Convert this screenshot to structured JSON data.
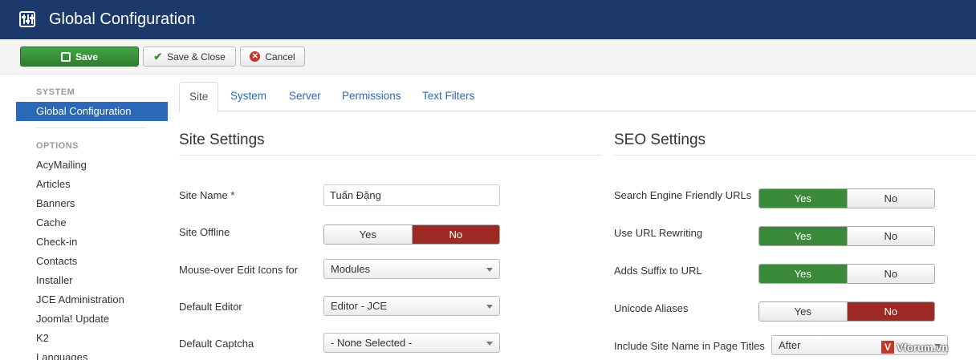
{
  "header": {
    "title": "Global Configuration",
    "logo_icon": "sliders-icon"
  },
  "toolbar": {
    "save_label": "Save",
    "save_close_label": "Save & Close",
    "cancel_label": "Cancel"
  },
  "sidebar": {
    "system_heading": "SYSTEM",
    "active_item": "Global Configuration",
    "options_heading": "OPTIONS",
    "items": [
      "AcyMailing",
      "Articles",
      "Banners",
      "Cache",
      "Check-in",
      "Contacts",
      "Installer",
      "JCE Administration",
      "Joomla! Update",
      "K2",
      "Languages"
    ]
  },
  "tabs": [
    "Site",
    "System",
    "Server",
    "Permissions",
    "Text Filters"
  ],
  "site_settings": {
    "title": "Site Settings",
    "site_name_label": "Site Name *",
    "site_name_value": "Tuấn Đặng",
    "site_offline_label": "Site Offline",
    "site_offline": {
      "yes": "Yes",
      "no": "No",
      "selected": "No"
    },
    "mouseover_label": "Mouse-over Edit Icons for",
    "mouseover_value": "Modules",
    "default_editor_label": "Default Editor",
    "default_editor_value": "Editor - JCE",
    "default_captcha_label": "Default Captcha",
    "default_captcha_value": "- None Selected -"
  },
  "seo_settings": {
    "title": "SEO Settings",
    "rows": [
      {
        "label": "Search Engine Friendly URLs",
        "yes": "Yes",
        "no": "No",
        "selected": "Yes"
      },
      {
        "label": "Use URL Rewriting",
        "yes": "Yes",
        "no": "No",
        "selected": "Yes"
      },
      {
        "label": "Adds Suffix to URL",
        "yes": "Yes",
        "no": "No",
        "selected": "Yes"
      },
      {
        "label": "Unicode Aliases",
        "yes": "Yes",
        "no": "No",
        "selected": "No"
      }
    ],
    "site_name_titles_label": "Include Site Name in Page Titles",
    "site_name_titles_value": "After"
  },
  "watermark": {
    "logo": "V",
    "text": "Vforum.vn"
  },
  "colors": {
    "header_bg": "#1b3a6b",
    "active_blue": "#2a69b8",
    "yes_green": "#3a8a3a",
    "no_red": "#9b2a24"
  }
}
